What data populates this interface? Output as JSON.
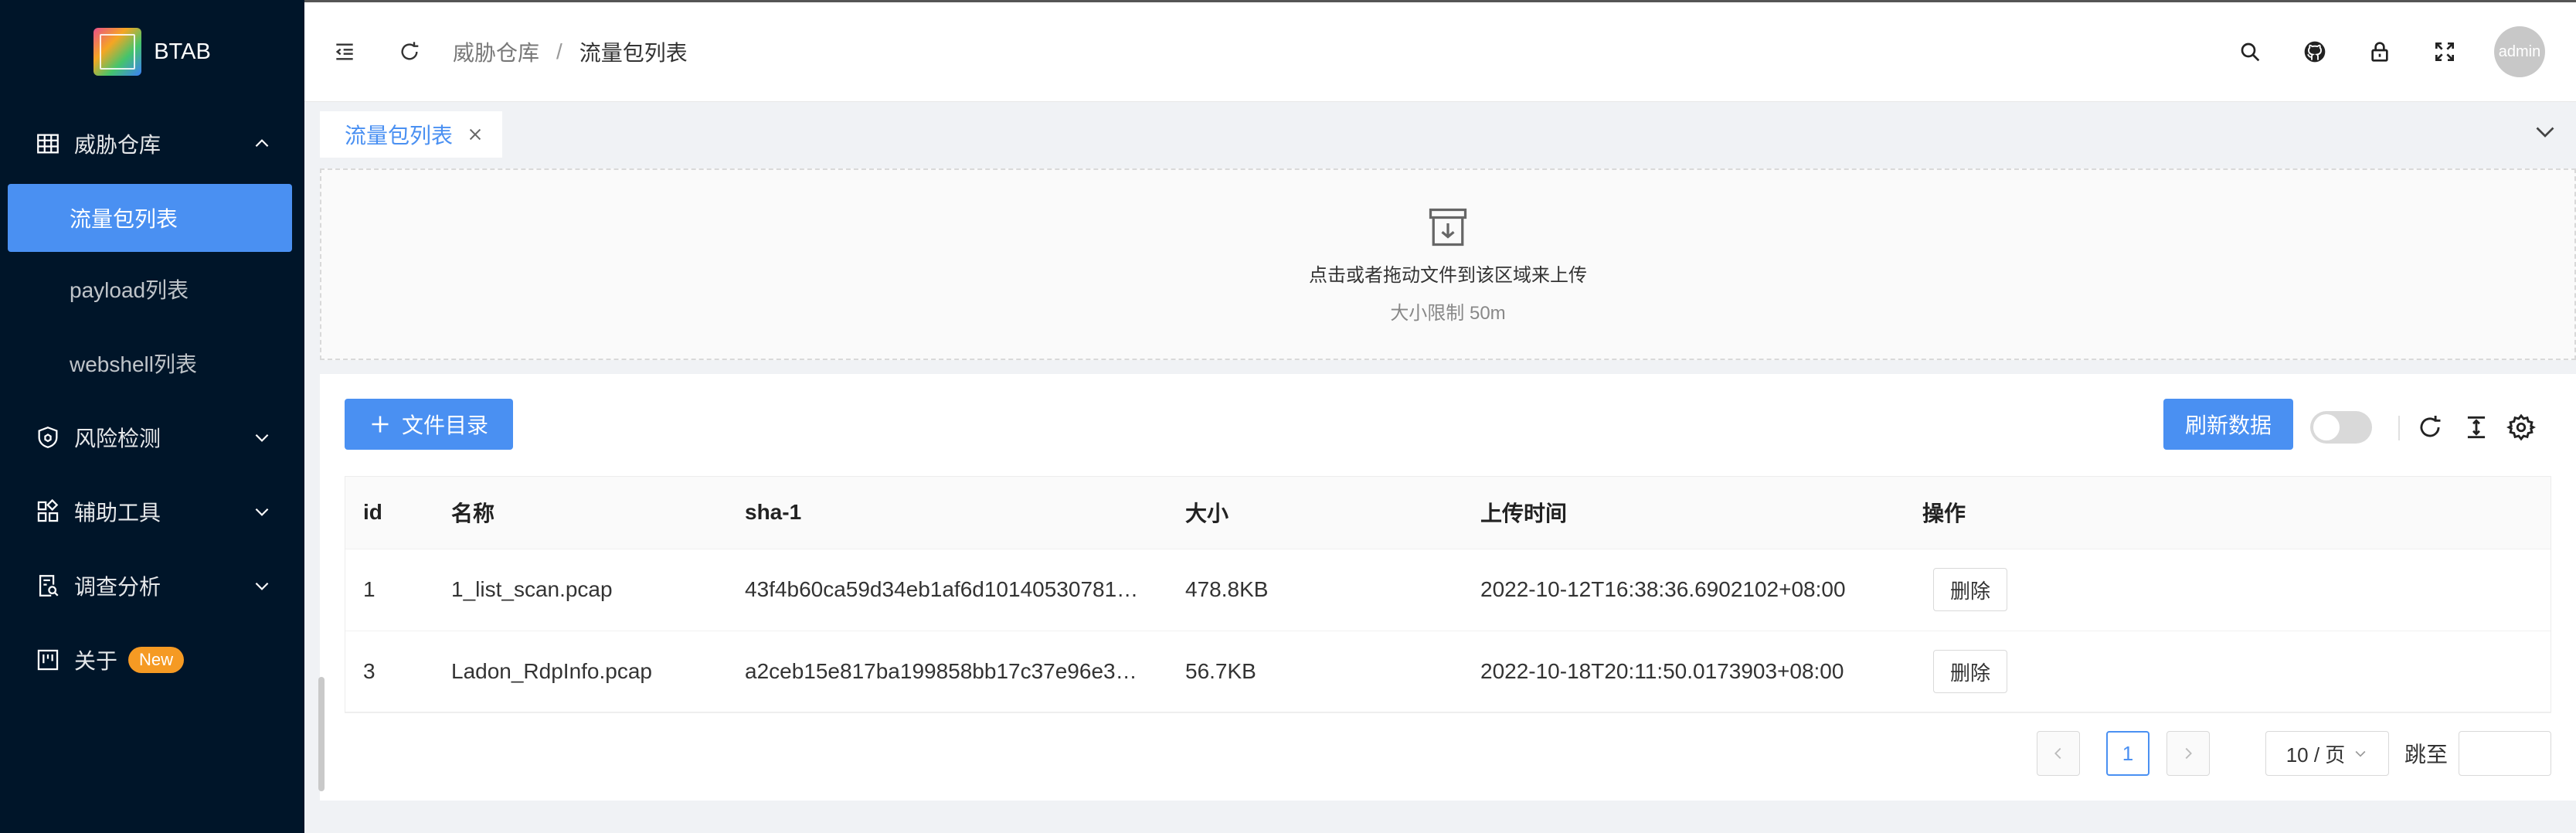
{
  "app": {
    "name": "BTAB"
  },
  "sidebar": {
    "groups": [
      {
        "label": "威胁仓库",
        "icon": "table-icon",
        "expanded": true,
        "items": [
          {
            "label": "流量包列表",
            "active": true
          },
          {
            "label": "payload列表",
            "active": false
          },
          {
            "label": "webshell列表",
            "active": false
          }
        ]
      },
      {
        "label": "风险检测",
        "icon": "shield-icon",
        "expanded": false
      },
      {
        "label": "辅助工具",
        "icon": "apps-icon",
        "expanded": false
      },
      {
        "label": "调查分析",
        "icon": "file-search-icon",
        "expanded": false
      },
      {
        "label": "关于",
        "icon": "project-icon",
        "badge": "New"
      }
    ]
  },
  "header": {
    "breadcrumb": [
      "威胁仓库",
      "流量包列表"
    ],
    "breadcrumb_separator": "/",
    "user": "admin"
  },
  "tabs": [
    {
      "label": "流量包列表"
    }
  ],
  "upload": {
    "text": "点击或者拖动文件到该区域来上传",
    "hint": "大小限制 50m"
  },
  "toolbar": {
    "add_button": "文件目录",
    "refresh_button": "刷新数据",
    "toggle_on": false
  },
  "table": {
    "columns": [
      "id",
      "名称",
      "sha-1",
      "大小",
      "上传时间",
      "操作"
    ],
    "rows": [
      {
        "id": "1",
        "name": "1_list_scan.pcap",
        "sha1": "43f4b60ca59d34eb1af6d10140530781…",
        "size": "478.8KB",
        "uploaded": "2022-10-12T16:38:36.6902102+08:00",
        "action": "删除"
      },
      {
        "id": "3",
        "name": "Ladon_RdpInfo.pcap",
        "sha1": "a2ceb15e817ba199858bb17c37e96e3…",
        "size": "56.7KB",
        "uploaded": "2022-10-18T20:11:50.0173903+08:00",
        "action": "删除"
      }
    ]
  },
  "pagination": {
    "current_page": "1",
    "page_size": "10 / 页",
    "jump_label": "跳至"
  },
  "colors": {
    "primary": "#4a90f2",
    "sidebar_bg": "#001529",
    "badge": "#f59a23"
  }
}
